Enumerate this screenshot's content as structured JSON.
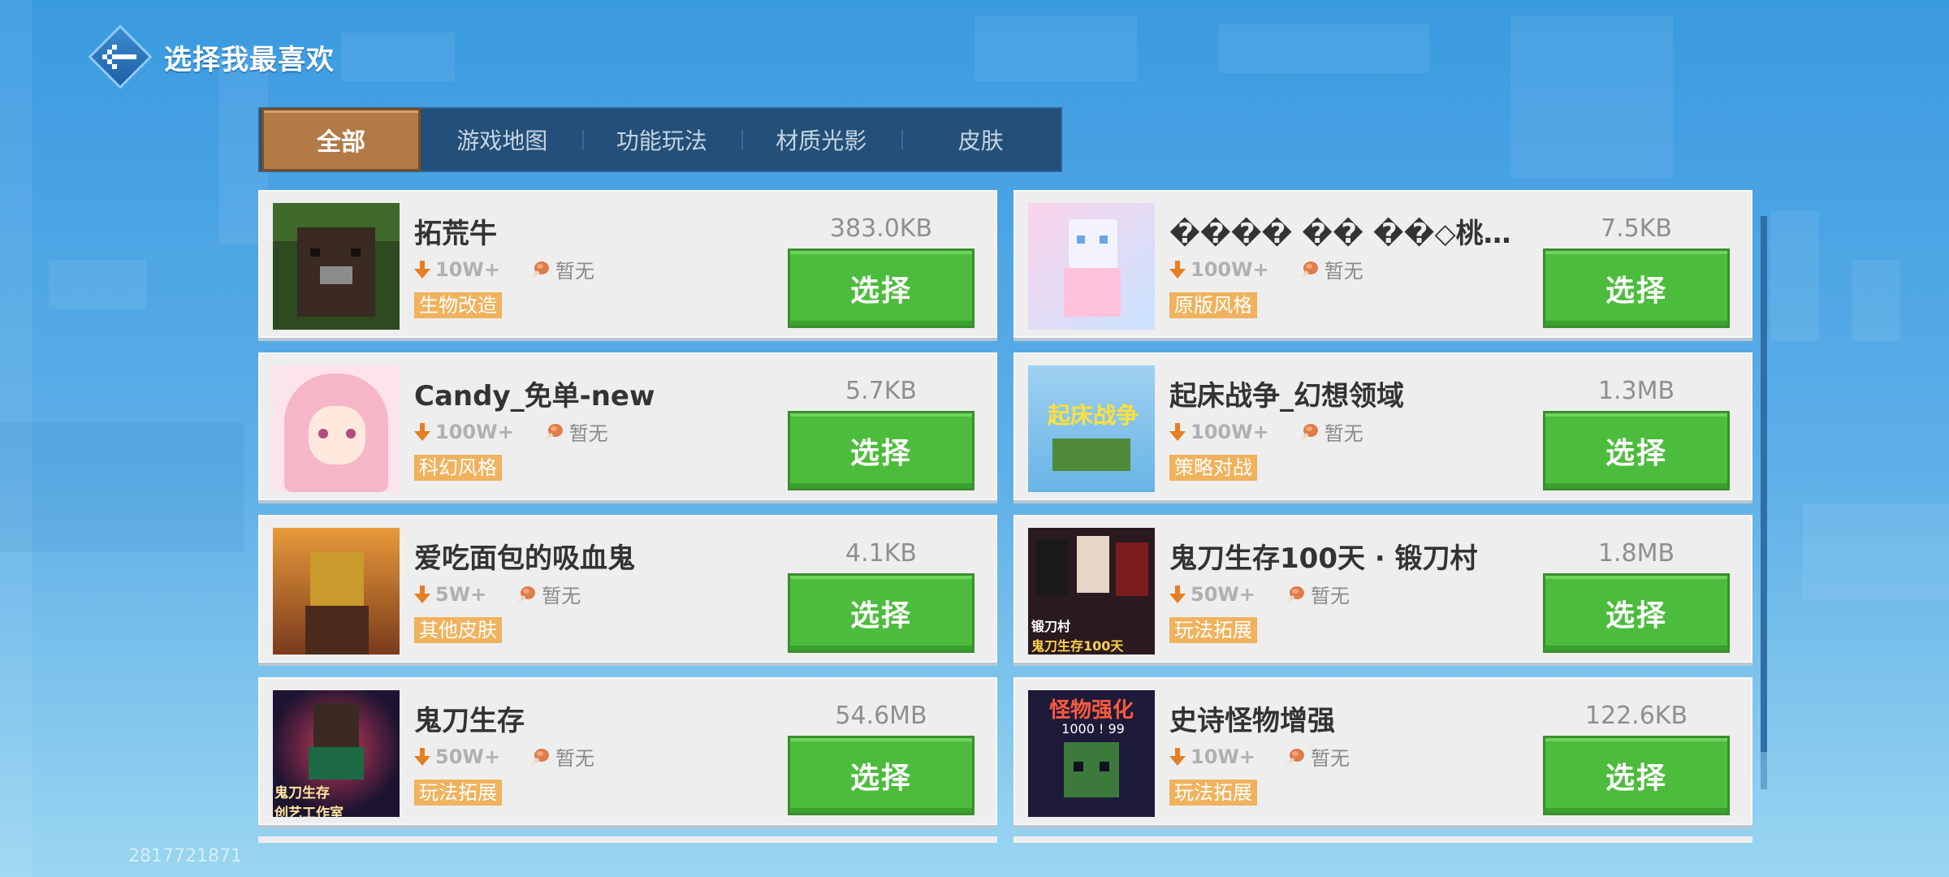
{
  "header": {
    "title": "选择我最喜欢",
    "back_icon": "back-arrow-icon"
  },
  "tabs": [
    {
      "label": "全部",
      "active": true
    },
    {
      "label": "游戏地图",
      "active": false
    },
    {
      "label": "功能玩法",
      "active": false
    },
    {
      "label": "材质光影",
      "active": false
    },
    {
      "label": "皮肤",
      "active": false
    }
  ],
  "items": [
    {
      "name": "拓荒牛",
      "size": "383.0KB",
      "downloads": "10W+",
      "rating": "暂无",
      "tag": "生物改造",
      "button": "选择",
      "thumb_icon": "cow-thumbnail"
    },
    {
      "name": "���� �� ��◇桃染…",
      "size": "7.5KB",
      "downloads": "100W+",
      "rating": "暂无",
      "tag": "原版风格",
      "button": "选择",
      "thumb_icon": "anime-skin-thumbnail"
    },
    {
      "name": "Candy_免单-new",
      "size": "5.7KB",
      "downloads": "100W+",
      "rating": "暂无",
      "tag": "科幻风格",
      "button": "选择",
      "thumb_icon": "pink-hair-girl-thumbnail"
    },
    {
      "name": "起床战争_幻想领域",
      "size": "1.3MB",
      "downloads": "100W+",
      "rating": "暂无",
      "tag": "策略对战",
      "button": "选择",
      "thumb_icon": "bedwars-thumbnail",
      "thumb_text": "起床战争"
    },
    {
      "name": "爱吃面包的吸血鬼",
      "size": "4.1KB",
      "downloads": "5W+",
      "rating": "暂无",
      "tag": "其他皮肤",
      "button": "选择",
      "thumb_icon": "vampire-skin-thumbnail"
    },
    {
      "name": "鬼刀生存100天 · 锻刀村",
      "size": "1.8MB",
      "downloads": "50W+",
      "rating": "暂无",
      "tag": "玩法拓展",
      "button": "选择",
      "thumb_icon": "demon-blade-village-thumbnail",
      "thumb_text": "锻刀村 鬼刀生存100天"
    },
    {
      "name": "鬼刀生存",
      "size": "54.6MB",
      "downloads": "50W+",
      "rating": "暂无",
      "tag": "玩法拓展",
      "button": "选择",
      "thumb_icon": "demon-blade-thumbnail",
      "thumb_text": "鬼刀生存 创艺工作室"
    },
    {
      "name": "史诗怪物增强",
      "size": "122.6KB",
      "downloads": "10W+",
      "rating": "暂无",
      "tag": "玩法拓展",
      "button": "选择",
      "thumb_icon": "monster-zombie-thumbnail",
      "thumb_text": "怪物强化 1000 99"
    }
  ],
  "footer": {
    "user_id": "2817721871"
  },
  "colors": {
    "select_green": "#4cbc3c",
    "tag_orange": "#f0b25c",
    "tab_bar": "#234f78",
    "active_tab": "#b27a47"
  }
}
